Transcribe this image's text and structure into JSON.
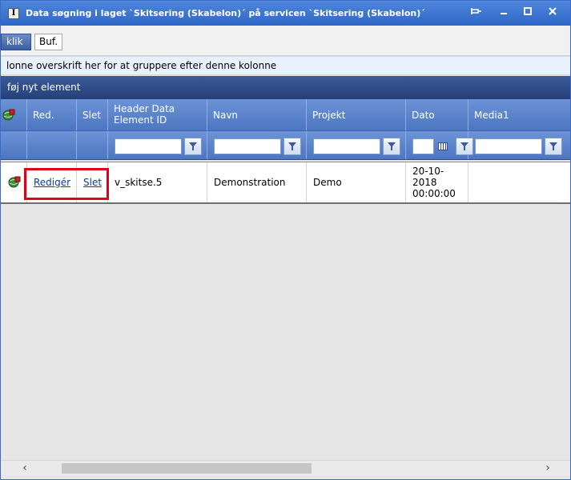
{
  "window": {
    "title": "Data søgning i laget `Skitsering (Skabelon)´ på servicen `Skitsering (Skabelon)´",
    "icon": "app-info-icon"
  },
  "toolbar": {
    "klik_label": "klik",
    "buf_label": "Buf."
  },
  "group_bar": {
    "text": "lonne overskrift her for at gruppere efter denne kolonne"
  },
  "add_bar": {
    "text": "føj nyt element"
  },
  "grid": {
    "columns": [
      {
        "key": "icon",
        "label": ""
      },
      {
        "key": "red",
        "label": "Red."
      },
      {
        "key": "slet",
        "label": "Slet"
      },
      {
        "key": "header_data_element_id",
        "label_line1": "Header Data",
        "label_line2": "Element ID"
      },
      {
        "key": "navn",
        "label": "Navn"
      },
      {
        "key": "projekt",
        "label": "Projekt"
      },
      {
        "key": "dato",
        "label": "Dato"
      },
      {
        "key": "media1",
        "label": "Media1"
      }
    ],
    "rows": [
      {
        "red": "Redigér",
        "slet": "Slet",
        "header_data_element_id": "v_skitse.5",
        "navn": "Demonstration",
        "projekt": "Demo",
        "dato_line1": "20-10-",
        "dato_line2": "2018",
        "dato_line3": "00:00:00",
        "media1": ""
      }
    ]
  },
  "colors": {
    "title_bar": "#2f67c8",
    "header": "#4c76c2",
    "highlight": "#e0001b",
    "link": "#0a3aa0"
  }
}
